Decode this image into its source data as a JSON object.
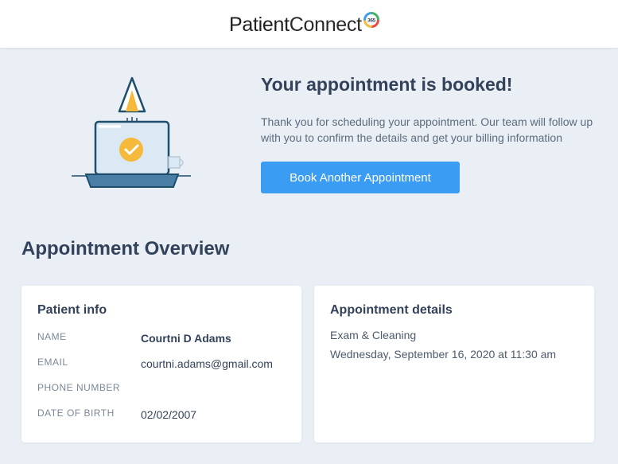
{
  "brand": {
    "name_part1": "Patient",
    "name_part2": "Connect",
    "badge_text": "365"
  },
  "hero": {
    "title": "Your appointment is booked!",
    "message": "Thank you for scheduling your appointment. Our team will follow up with you to confirm the details and get your billing information",
    "button_label": "Book Another Appointment"
  },
  "overview": {
    "title": "Appointment Overview",
    "patient_info": {
      "title": "Patient info",
      "rows": [
        {
          "label": "NAME",
          "value": "Courtni D Adams"
        },
        {
          "label": "EMAIL",
          "value": "courtni.adams@gmail.com"
        },
        {
          "label": "PHONE NUMBER",
          "value": ""
        },
        {
          "label": "DATE OF BIRTH",
          "value": "02/02/2007"
        }
      ]
    },
    "appointment_details": {
      "title": "Appointment details",
      "service": "Exam & Cleaning",
      "datetime": "Wednesday, September 16, 2020 at 11:30 am"
    }
  },
  "colors": {
    "background": "#e9eff4",
    "accent": "#3b9cf3",
    "heading": "#33425b",
    "check_badge": "#f5b93b"
  }
}
